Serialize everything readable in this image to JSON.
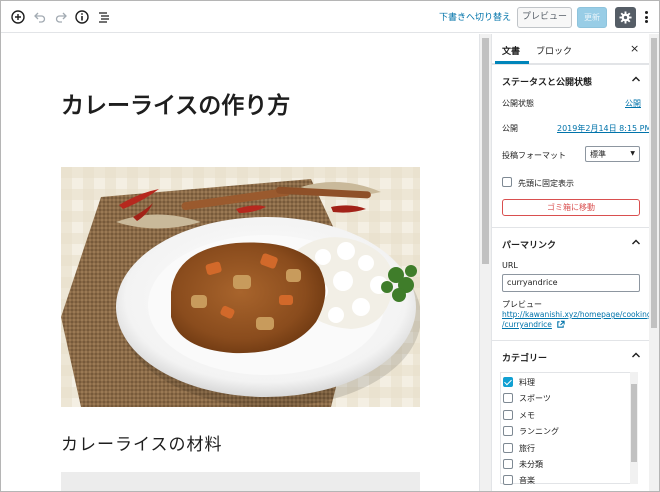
{
  "toolbar": {
    "icons": [
      "add-block-icon",
      "undo-icon",
      "redo-icon",
      "info-icon",
      "outline-icon",
      "gear-icon",
      "more-options-icon"
    ],
    "switch_draft_label": "下書きへ切り替え",
    "preview_label": "プレビュー",
    "update_label": "更新"
  },
  "editor": {
    "post_title": "カレーライスの作り方",
    "heading": "カレーライスの材料"
  },
  "sidebar": {
    "tabs": [
      "文書",
      "ブロック"
    ],
    "close_label": "×",
    "status_panel": {
      "title": "ステータスと公開状態",
      "visibility_label": "公開状態",
      "visibility_value": "公開",
      "publish_label": "公開",
      "publish_value": "2019年2月14日 8:15 PM",
      "format_label": "投稿フォーマット",
      "format_value": "標準",
      "sticky_label": "先頭に固定表示",
      "trash_label": "ゴミ箱に移動"
    },
    "permalink_panel": {
      "title": "パーマリンク",
      "url_label": "URL",
      "url_value": "curryandrice",
      "preview_label": "プレビュー",
      "preview_link_1": "http://kawanishi.xyz/homepage/cooking",
      "preview_link_2": "/curryandrice"
    },
    "category_panel": {
      "title": "カテゴリー",
      "items": [
        {
          "label": "料理",
          "checked": true
        },
        {
          "label": "スポーツ",
          "checked": false
        },
        {
          "label": "メモ",
          "checked": false
        },
        {
          "label": "ランニング",
          "checked": false
        },
        {
          "label": "旅行",
          "checked": false
        },
        {
          "label": "未分類",
          "checked": false
        },
        {
          "label": "音楽",
          "checked": false
        }
      ]
    }
  },
  "colors": {
    "accent": "#0085ba",
    "link": "#0073aa",
    "danger": "#d94f4f",
    "gear_bg": "#555d66"
  }
}
